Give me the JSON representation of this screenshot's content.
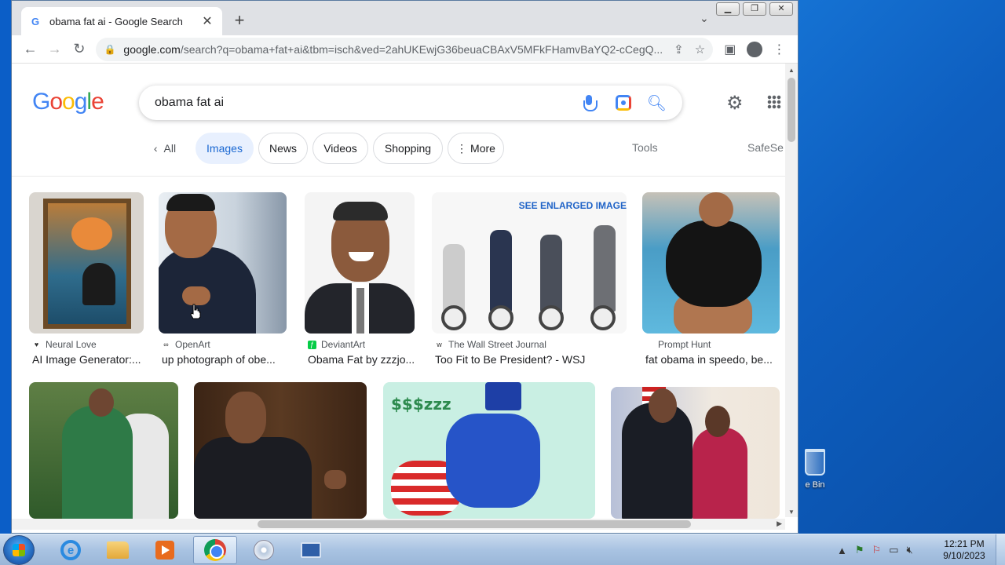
{
  "browser": {
    "tab_title": "obama fat ai - Google Search",
    "tab_favicon": "G",
    "new_tab_label": "+",
    "url_domain": "google.com",
    "url_path": "/search?q=obama+fat+ai&tbm=isch&ved=2ahUKEwjG36beuaCBAxV5MFkFHamvBaYQ2-cCegQ..."
  },
  "google": {
    "logo_letters": [
      "G",
      "o",
      "o",
      "g",
      "l",
      "e"
    ],
    "search_query": "obama fat ai"
  },
  "chips": {
    "all": "All",
    "images": "Images",
    "news": "News",
    "videos": "Videos",
    "shopping": "Shopping",
    "more": "More",
    "tools": "Tools",
    "safesearch": "SafeSe"
  },
  "results": [
    {
      "source": "Neural Love",
      "caption": "AI Image Generator:..."
    },
    {
      "source": "OpenArt",
      "caption": "up photograph of obe..."
    },
    {
      "source": "DeviantArt",
      "caption": "Obama Fat by zzzjo..."
    },
    {
      "source": "The Wall Street Journal",
      "caption": "Too Fit to Be President? - WSJ",
      "image_text": "SEE ENLARGED IMAGE"
    },
    {
      "source": "Prompt Hunt",
      "caption": "fat obama in speedo, be..."
    }
  ],
  "desktop": {
    "recycle_bin_label": "e Bin"
  },
  "taskbar": {
    "time": "12:21 PM",
    "date": "9/10/2023"
  }
}
